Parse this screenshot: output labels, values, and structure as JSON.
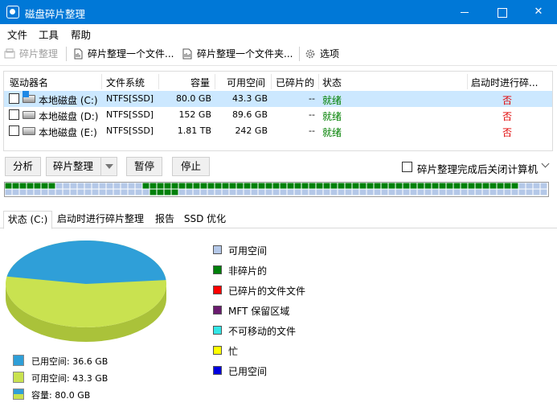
{
  "window": {
    "title": "磁盘碎片整理"
  },
  "menu": [
    "文件",
    "工具",
    "帮助"
  ],
  "toolbar": {
    "defrag": "碎片整理",
    "defrag_file": "碎片整理一个文件...",
    "defrag_folder": "碎片整理一个文件夹...",
    "options": "选项"
  },
  "drive_list": {
    "columns": [
      "驱动器名",
      "文件系统",
      "容量",
      "可用空间",
      "已碎片的",
      "状态",
      "启动时进行碎..."
    ],
    "rows": [
      {
        "name": "本地磁盘 (C:)",
        "fs": "NTFS[SSD]",
        "capacity": "80.0 GB",
        "free": "43.3 GB",
        "fragmented": "--",
        "status": "就绪",
        "boot": "否",
        "selected": true
      },
      {
        "name": "本地磁盘 (D:)",
        "fs": "NTFS[SSD]",
        "capacity": "152 GB",
        "free": "89.6 GB",
        "fragmented": "--",
        "status": "就绪",
        "boot": "否",
        "selected": false
      },
      {
        "name": "本地磁盘 (E:)",
        "fs": "NTFS[SSD]",
        "capacity": "1.81 TB",
        "free": "242 GB",
        "fragmented": "--",
        "status": "就绪",
        "boot": "否",
        "selected": false
      }
    ]
  },
  "actions": {
    "analyze": "分析",
    "defrag": "碎片整理",
    "pause": "暂停",
    "stop": "停止",
    "shutdown_label": "碎片整理完成后关闭计算机"
  },
  "tabs": [
    "状态 (C:)",
    "启动时进行碎片整理",
    "报告",
    "SSD 优化"
  ],
  "legend_right": [
    {
      "label": "可用空间",
      "color": "#b4c8e8"
    },
    {
      "label": "非碎片的",
      "color": "#00800b"
    },
    {
      "label": "已碎片的文件文件",
      "color": "#ff0000"
    },
    {
      "label": "MFT 保留区域",
      "color": "#6a1b6f"
    },
    {
      "label": "不可移动的文件",
      "color": "#33e6e6"
    },
    {
      "label": "忙",
      "color": "#ffff00"
    },
    {
      "label": "已用空间",
      "color": "#0000e0"
    }
  ],
  "legend_left": [
    {
      "label": "已用空间: 36.6 GB",
      "color": "#2f9fd8"
    },
    {
      "label": "可用空间: 43.3 GB",
      "color": "#c9e250"
    },
    {
      "label": "容量: 80.0 GB",
      "color": "#2f9fd8"
    }
  ],
  "usage": {
    "used_gb": 36.6,
    "free_gb": 43.3,
    "capacity_gb": 80.0
  }
}
